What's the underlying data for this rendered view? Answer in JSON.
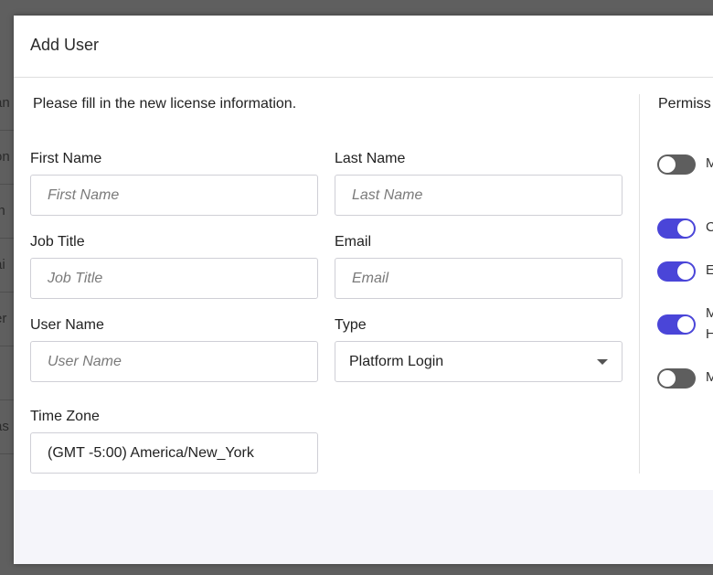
{
  "background": {
    "rows": [
      "an",
      "on",
      "in",
      "ai",
      "er",
      "",
      "as"
    ]
  },
  "modal": {
    "title": "Add User",
    "instructions": "Please fill in the new license information.",
    "fields": {
      "first_name": {
        "label": "First Name",
        "value": "",
        "placeholder": "First Name"
      },
      "last_name": {
        "label": "Last Name",
        "value": "",
        "placeholder": "Last Name"
      },
      "job_title": {
        "label": "Job Title",
        "value": "",
        "placeholder": "Job Title"
      },
      "email": {
        "label": "Email",
        "value": "",
        "placeholder": "Email"
      },
      "user_name": {
        "label": "User Name",
        "value": "",
        "placeholder": "User Name"
      },
      "type": {
        "label": "Type",
        "value": "Platform Login"
      },
      "time_zone": {
        "label": "Time Zone",
        "value": "(GMT -5:00) America/New_York"
      }
    },
    "permissions": {
      "title": "Permiss",
      "items": [
        {
          "label": "M",
          "enabled": false
        },
        {
          "label": "C",
          "enabled": true
        },
        {
          "label": "E",
          "enabled": true
        },
        {
          "label": "M",
          "label2": "H",
          "enabled": true
        },
        {
          "label": "M",
          "enabled": false
        }
      ]
    }
  },
  "colors": {
    "toggle_on": "#4a45d8",
    "toggle_off": "#5e5e5e"
  }
}
